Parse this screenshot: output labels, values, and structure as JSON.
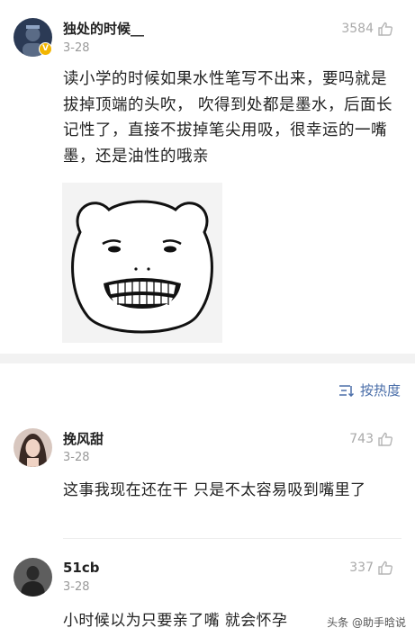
{
  "post": {
    "username": "独处的时候__",
    "date": "3-28",
    "likes": "3584",
    "text": "读小学的时候如果水性笔写不出来，要吗就是拔掉顶端的头吹， 吹得到处都是墨水，后面长记性了，直接不拔掉笔尖用吸，很幸运的一嘴墨，还是油性的哦亲",
    "badge": "V"
  },
  "sort": {
    "label": "按热度"
  },
  "replies": [
    {
      "username": "挽风甜",
      "date": "3-28",
      "likes": "743",
      "text": "这事我现在还在干 只是不太容易吸到嘴里了"
    },
    {
      "username": "51cb",
      "date": "3-28",
      "likes": "337",
      "text": "小时候以为只要亲了嘴 就会怀孕"
    }
  ],
  "watermark": "头条 @助手晗说",
  "colors": {
    "accent": "#4a6ea9",
    "muted": "#999999",
    "badge": "#f2b500"
  },
  "icons": [
    "thumbs-up-icon",
    "sort-icon",
    "verified-badge-icon"
  ]
}
